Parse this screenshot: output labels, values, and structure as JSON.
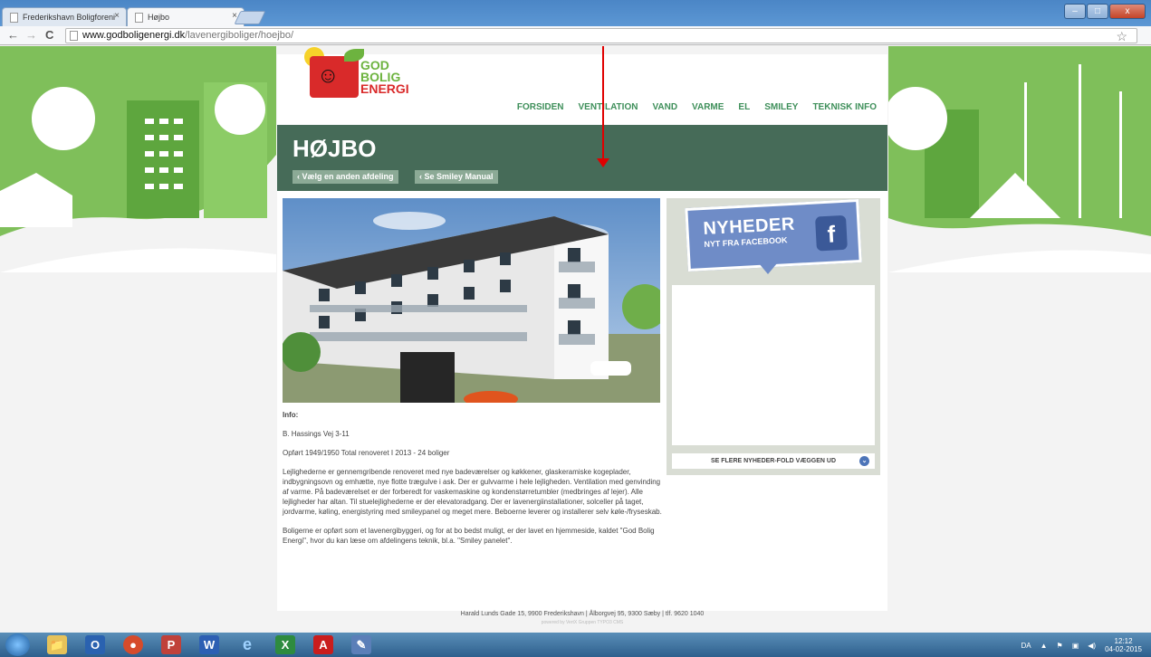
{
  "browser": {
    "tabs": [
      {
        "title": "Frederikshavn Boligforeni",
        "close": "×"
      },
      {
        "title": "Højbo",
        "close": "×"
      }
    ],
    "url_host": "www.godboligenergi.dk",
    "url_path": "/lavenergiboliger/hoejbo/",
    "back": "←",
    "forward": "→",
    "reload": "C",
    "star": "☆",
    "win_min": "–",
    "win_max": "□",
    "win_close": "x"
  },
  "site": {
    "logo_lines": [
      "GOD",
      "BOLIG",
      "ENERGI"
    ],
    "nav": [
      "FORSIDEN",
      "VENTILATION",
      "VAND",
      "VARME",
      "EL",
      "SMILEY",
      "TEKNISK INFO"
    ],
    "page_title": "HØJBO",
    "pill_1": "‹ Vælg en anden afdeling",
    "pill_2": "‹ Se Smiley Manual",
    "info_label": "Info:",
    "address": "B. Hassings Vej 3-11",
    "built": "Opført 1949/1950 Total renoveret I 2013 - 24 boliger",
    "description": "Lejlighederne er gennemgribende renoveret med nye badeværelser og køkkener, glaskeramiske kogeplader, indbygningsovn og emhætte, nye flotte trægulve i ask. Der er gulvvarme i hele lejligheden. Ventilation med genvinding af varme. På badeværelset er der forberedt for vaskemaskine og kondenstørretumbler (medbringes af lejer). Alle lejligheder har altan. Til stuelejlighederne er der elevatoradgang. Der er lavenergiinstallationer, solceller på taget, jordvarme, køling,  energistyring med smileypanel og meget mere. Beboerne leverer og installerer selv køle-/fryseskab.",
    "closing": "Boligerne er opført som et lavenergibyggeri, og for at bo bedst muligt, er der lavet en hjemmeside, kaldet \"God Bolig Energi\", hvor du kan læse om afdelingens teknik, bl.a. \"Smiley panelet\".",
    "news_title": "NYHEDER",
    "news_sub": "NYT FRA FACEBOOK",
    "fb_letter": "f",
    "more_button": "SE FLERE NYHEDER-FOLD VÆGGEN UD",
    "more_chev": "⌄",
    "footer_address": "Harald Lunds Gade 15, 9900 Frederikshavn  |  Ålborgvej 95, 9300 Sæby  |  tlf. 9620 1040",
    "footer_powered": "powered by VertX Gruppen TYPO3 CMS"
  },
  "taskbar": {
    "apps": [
      "📁",
      "O",
      "●",
      "P",
      "W",
      "e",
      "X",
      "A",
      "✎"
    ],
    "lang": "DA",
    "time": "12:12",
    "date": "04-02-2015"
  },
  "colors": {
    "banner": "#466b58",
    "nav_text": "#3e8f5a",
    "annotation_arrow": "#e00000",
    "facebook_blue": "#3b5998"
  }
}
